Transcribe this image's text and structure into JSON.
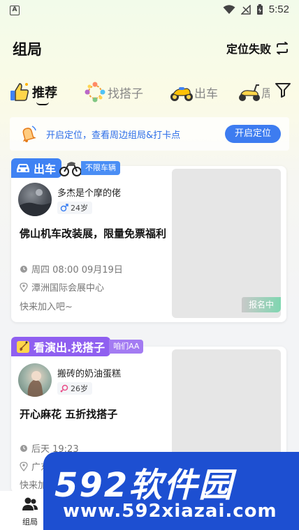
{
  "status_bar": {
    "app_letter": "A",
    "time": "5:52"
  },
  "header": {
    "title": "组局",
    "location_status": "定位失败"
  },
  "tabs": [
    {
      "label": "推荐",
      "icon": "thumbs-up-icon",
      "active": true
    },
    {
      "label": "找搭子",
      "icon": "people-circle-icon",
      "active": false
    },
    {
      "label": "出车",
      "icon": "motorcycle-icon",
      "active": false
    },
    {
      "label": "周",
      "icon": "scooter-icon",
      "active": false
    }
  ],
  "banner": {
    "text": "开启定位，查看周边组局&打卡点",
    "button": "开启定位"
  },
  "cards": [
    {
      "tag": "出车",
      "subtag": "不限车辆",
      "user_name": "多杰是个摩的佬",
      "age": "24岁",
      "gender": "male",
      "title": "佛山机车改装展，限量免票福利",
      "time": "周四 08:00 09月19日",
      "place": "潭洲国际会展中心",
      "note": "快来加入吧~",
      "status": "报名中"
    },
    {
      "tag": "看演出.找搭子",
      "subtag": "咱们AA",
      "user_name": "搬砖的奶油蛋糕",
      "age": "26岁",
      "gender": "female",
      "title": "开心麻花 五折找搭子",
      "time": "后天 19:23",
      "place": "广东",
      "note": "快来加"
    }
  ],
  "bottom_nav": {
    "label": "组局"
  },
  "watermark": {
    "big": "592软件园",
    "small": "www.592xiazai.com"
  },
  "colors": {
    "accent": "#3d7cf0",
    "tag_blue": "#3f82f3",
    "tag_purple": "#8f5ff0",
    "male": "#3b7ff2",
    "female": "#e94d88"
  }
}
